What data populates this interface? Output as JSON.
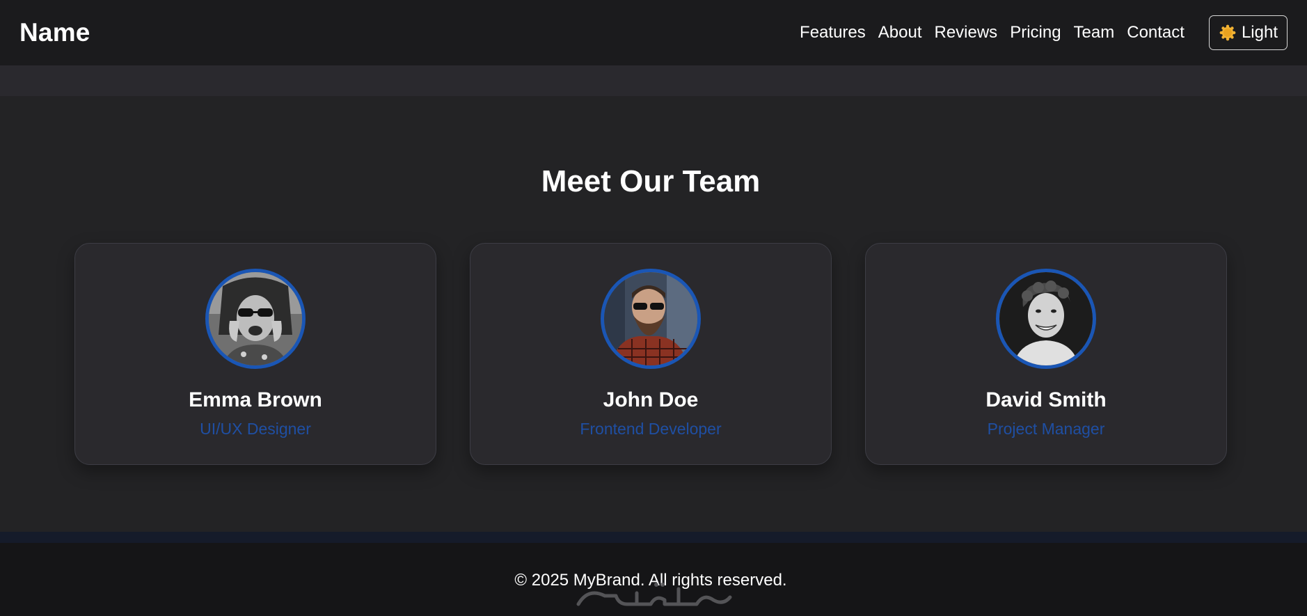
{
  "header": {
    "brand": "Name",
    "nav": [
      "Features",
      "About",
      "Reviews",
      "Pricing",
      "Team",
      "Contact"
    ],
    "theme_toggle": {
      "label": "Light",
      "icon": "sun-icon"
    }
  },
  "team": {
    "title": "Meet Our Team",
    "members": [
      {
        "name": "Emma Brown",
        "role": "UI/UX Designer",
        "avatar": "woman-sunglasses-photo"
      },
      {
        "name": "John Doe",
        "role": "Frontend Developer",
        "avatar": "bearded-man-sunglasses-photo"
      },
      {
        "name": "David Smith",
        "role": "Project Manager",
        "avatar": "smiling-man-curly-hair-photo"
      }
    ]
  },
  "footer": {
    "copyright": "© 2025 MyBrand. All rights reserved.",
    "watermark": "خمسات"
  },
  "colors": {
    "accent": "#1a56b5",
    "role_text": "#1f4fa3",
    "navbar_bg": "#1b1b1d",
    "section_bg": "#232325",
    "card_bg": "#2a292d",
    "sun": "#f2b233"
  }
}
